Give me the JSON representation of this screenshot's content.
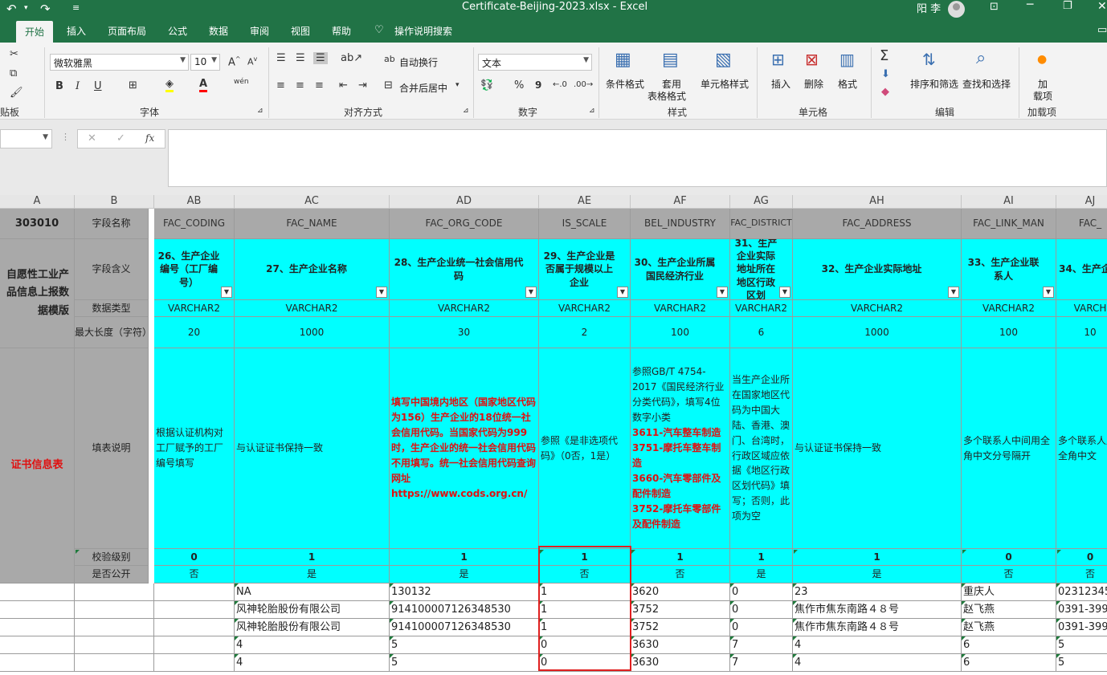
{
  "window": {
    "title": "Certificate-Beijing-2023.xlsx  -  Excel",
    "user": "阳 李"
  },
  "tabs": [
    "开始",
    "插入",
    "页面布局",
    "公式",
    "数据",
    "审阅",
    "视图",
    "帮助",
    "操作说明搜索"
  ],
  "ribbon": {
    "font_name": "微软雅黑",
    "font_size": "10",
    "wrap": "自动换行",
    "merge": "合并后居中",
    "number_format": "文本",
    "cond_format": "条件格式",
    "table_format_1": "套用",
    "table_format_2": "表格格式",
    "cell_style": "单元格样式",
    "insert": "插入",
    "delete": "删除",
    "format": "格式",
    "sort": "排序和筛选",
    "find": "查找和选择",
    "addin_1": "加",
    "addin_2": "载项",
    "groups": {
      "clipboard": "贴板",
      "font": "字体",
      "alignment": "对齐方式",
      "number": "数字",
      "styles": "样式",
      "cells": "单元格",
      "editing": "编辑",
      "addins": "加载项"
    },
    "bold": "B",
    "italic": "I",
    "underline": "U",
    "wen": "wén",
    "font_color": "A",
    "pct": "%",
    "comma": "9",
    "sigma": "Σ"
  },
  "formula_bar": {
    "cancel": "✕",
    "confirm": "✓",
    "fx": "fx",
    "value": ""
  },
  "columns": [
    "A",
    "B",
    "AB",
    "AC",
    "AD",
    "AE",
    "AF",
    "AG",
    "AH",
    "AI",
    "AJ"
  ],
  "sheet": {
    "a_id": "303010",
    "a_name": "自愿性工业产品信息上报数据模版",
    "a_cert": "证书信息表",
    "row_labels": [
      "字段名称",
      "字段含义",
      "数据类型",
      "最大长度（字符）",
      "填表说明",
      "校验级别",
      "是否公开"
    ],
    "fields": [
      {
        "name": "FAC_CODING",
        "meaning": "26、生产企业编号（工厂编号）",
        "type": "VARCHAR2",
        "max": "20",
        "desc": [
          {
            "t": "根据认证机构对工厂赋予的工厂编号填写",
            "red": false
          }
        ],
        "level": "0",
        "public": "否"
      },
      {
        "name": "FAC_NAME",
        "meaning": "27、生产企业名称",
        "type": "VARCHAR2",
        "max": "1000",
        "desc": [
          {
            "t": "与认证证书保持一致",
            "red": false
          }
        ],
        "level": "1",
        "public": "是"
      },
      {
        "name": "FAC_ORG_CODE",
        "meaning": "28、生产企业统一社会信用代码",
        "type": "VARCHAR2",
        "max": "30",
        "desc": [
          {
            "t": "填写中国境内地区（国家地区代码为156）生产企业的18位统一社会信用代码。当国家代码为999时，生产企业的统一社会信用代码不用填写。统一社会信用代码查询网址https://www.cods.org.cn/",
            "red": true
          }
        ],
        "level": "1",
        "public": "是"
      },
      {
        "name": "IS_SCALE",
        "meaning": "29、生产企业是否属于规模以上企业",
        "type": "VARCHAR2",
        "max": "2",
        "desc": [
          {
            "t": "参照《是非选项代码》（0否，1是）",
            "red": false
          }
        ],
        "level": "1",
        "public": "否"
      },
      {
        "name": "BEL_INDUSTRY",
        "meaning": "30、生产企业所属国民经济行业",
        "type": "VARCHAR2",
        "max": "100",
        "desc": [
          {
            "t": "参照GB/T 4754-2017《国民经济行业分类代码》，填写4位数字小类",
            "red": false
          },
          {
            "t": "3611-汽车整车制造",
            "red": true
          },
          {
            "t": "3751-摩托车整车制造",
            "red": true
          },
          {
            "t": "3660-汽车零部件及配件制造",
            "red": true
          },
          {
            "t": "3752-摩托车零部件及配件制造",
            "red": true
          }
        ],
        "level": "1",
        "public": "否"
      },
      {
        "name": "FAC_DISTRICT",
        "meaning": "31、生产企业实际地址所在地区行政区划",
        "type": "VARCHAR2",
        "max": "6",
        "desc": [
          {
            "t": "当生产企业所在国家地区代码为中国大陆、香港、澳门、台湾时，行政区域应依据《地区行政区划代码》填写；否则，此项为空",
            "red": false
          }
        ],
        "level": "1",
        "public": "是"
      },
      {
        "name": "FAC_ADDRESS",
        "meaning": "32、生产企业实际地址",
        "type": "VARCHAR2",
        "max": "1000",
        "desc": [
          {
            "t": "与认证证书保持一致",
            "red": false
          }
        ],
        "level": "1",
        "public": "是"
      },
      {
        "name": "FAC_LINK_MAN",
        "meaning": "33、生产企业联系人",
        "type": "VARCHAR2",
        "max": "100",
        "desc": [
          {
            "t": "多个联系人中间用全角中文分号隔开",
            "red": false
          }
        ],
        "level": "0",
        "public": "否"
      },
      {
        "name": "FAC_",
        "meaning": "34、生产企",
        "type": "VARCH",
        "max": "10",
        "desc": [
          {
            "t": "多个联系人用全角中文",
            "red": false
          }
        ],
        "level": "0",
        "public": "否"
      }
    ],
    "rows": [
      [
        "",
        "",
        "",
        "NA",
        "130132",
        "1",
        "3620",
        "0",
        "23",
        "重庆人",
        "02312345"
      ],
      [
        "",
        "",
        "",
        "风神轮胎股份有限公司",
        "914100007126348530",
        "1",
        "3752",
        "0",
        "焦作市焦东南路４８号",
        "赵飞燕",
        "0391-399"
      ],
      [
        "",
        "",
        "",
        "风神轮胎股份有限公司",
        "914100007126348530",
        "1",
        "3752",
        "0",
        "焦作市焦东南路４８号",
        "赵飞燕",
        "0391-399"
      ],
      [
        "",
        "",
        "",
        "4",
        "5",
        "0",
        "3630",
        "7",
        "4",
        "6",
        "5"
      ],
      [
        "",
        "",
        "",
        "4",
        "5",
        "0",
        "3630",
        "7",
        "4",
        "6",
        "5"
      ]
    ]
  },
  "colors": {
    "excel_green": "#217346",
    "cyan": "#00ffff",
    "gray": "#a9a9a9",
    "red_text": "#e01010",
    "highlight": "#e02020"
  }
}
